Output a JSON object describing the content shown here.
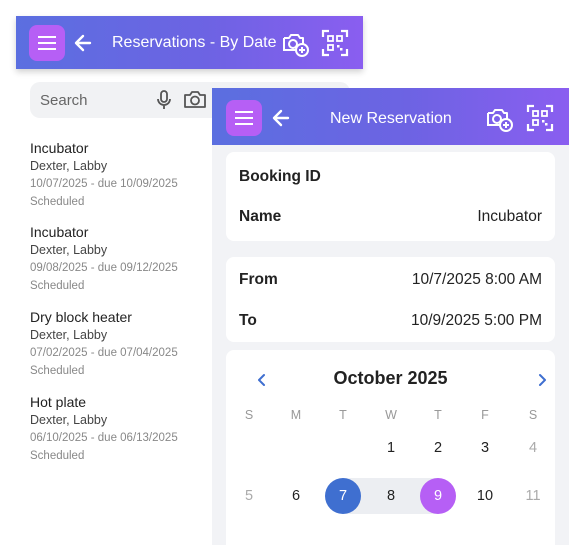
{
  "back_screen": {
    "header": {
      "title": "Reservations - By Date"
    },
    "search": {
      "placeholder": "Search"
    },
    "reservations": [
      {
        "item": "Incubator",
        "owner": "Dexter, Labby",
        "dates": "10/07/2025 - due 10/09/2025",
        "status": "Scheduled"
      },
      {
        "item": "Incubator",
        "owner": "Dexter, Labby",
        "dates": "09/08/2025 - due 09/12/2025",
        "status": "Scheduled"
      },
      {
        "item": "Dry block heater",
        "owner": "Dexter, Labby",
        "dates": "07/02/2025 - due 07/04/2025",
        "status": "Scheduled"
      },
      {
        "item": "Hot plate",
        "owner": "Dexter, Labby",
        "dates": "06/10/2025 - due 06/13/2025",
        "status": "Scheduled"
      }
    ]
  },
  "front_screen": {
    "header": {
      "title": "New Reservation"
    },
    "booking": {
      "booking_id_label": "Booking ID",
      "booking_id_value": "",
      "name_label": "Name",
      "name_value": "Incubator"
    },
    "time": {
      "from_label": "From",
      "from_value": "10/7/2025 8:00 AM",
      "to_label": "To",
      "to_value": "10/9/2025 5:00 PM"
    },
    "calendar": {
      "month_label": "October 2025",
      "weekdays": [
        "S",
        "M",
        "T",
        "W",
        "T",
        "F",
        "S"
      ],
      "week1": [
        "",
        "",
        "",
        "1",
        "2",
        "3",
        "4"
      ],
      "week2": [
        "5",
        "6",
        "7",
        "8",
        "9",
        "10",
        "11"
      ],
      "selected_start": "7",
      "selected_end": "9"
    }
  },
  "colors": {
    "header_gradient_start": "#5b6fe0",
    "header_gradient_end": "#8a5ef0",
    "menu_button": "#b65ff5",
    "range_start": "#3f6fd0",
    "range_end": "#b65ff5"
  },
  "icons": [
    "menu-icon",
    "back-arrow-icon",
    "add-photo-icon",
    "qr-scan-icon",
    "microphone-icon",
    "camera-icon",
    "chevron-left-icon",
    "chevron-right-icon"
  ]
}
